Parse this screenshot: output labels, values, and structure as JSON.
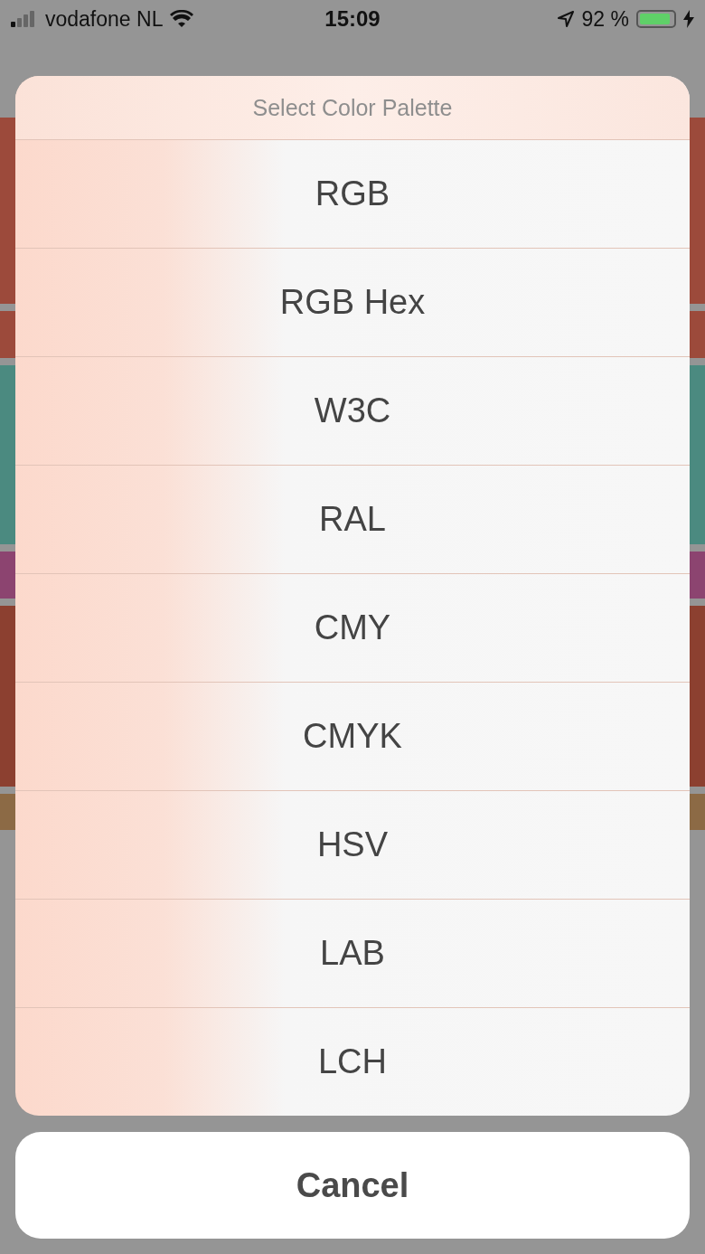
{
  "status_bar": {
    "carrier": "vodafone NL",
    "time": "15:09",
    "battery_percent": "92 %",
    "battery": {
      "level": 0.92
    }
  },
  "background_rows": [
    {
      "color": "#9c4a3b"
    },
    {
      "color": "#9c4a3b"
    },
    {
      "color": "#4b8a80"
    },
    {
      "color": "#8c4470"
    },
    {
      "color": "#8c4030"
    },
    {
      "color": "#8c6a45"
    }
  ],
  "action_sheet": {
    "title": "Select Color Palette",
    "options": [
      "RGB",
      "RGB Hex",
      "W3C",
      "RAL",
      "CMY",
      "CMYK",
      "HSV",
      "LAB",
      "LCH"
    ],
    "cancel": "Cancel"
  }
}
